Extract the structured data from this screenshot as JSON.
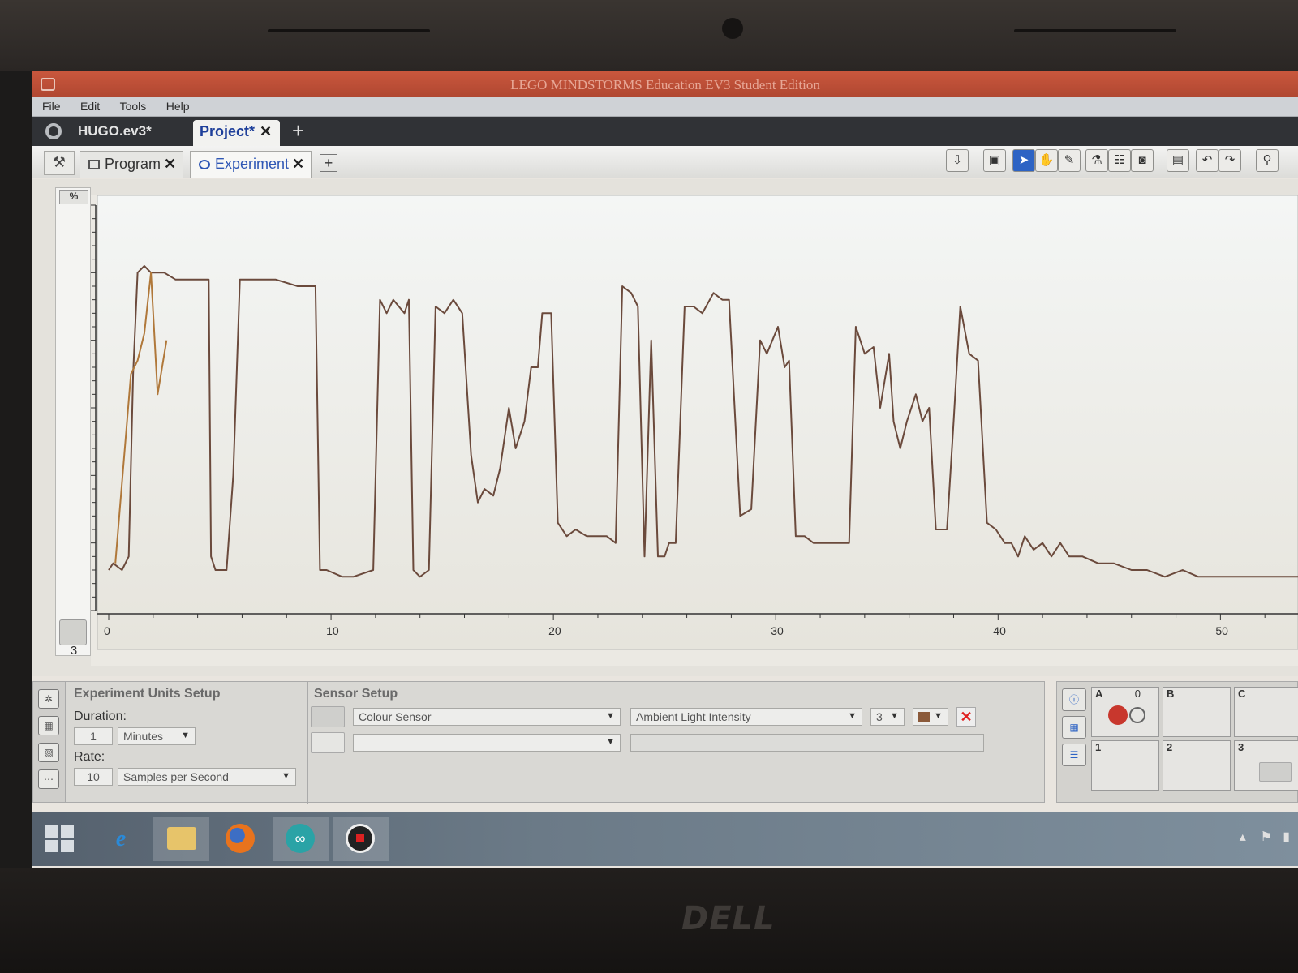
{
  "window": {
    "title": "LEGO MINDSTORMS Education EV3 Student Edition"
  },
  "menu": [
    "File",
    "Edit",
    "Tools",
    "Help"
  ],
  "project": {
    "file_label": "HUGO.ev3*",
    "tab_label": "Project*",
    "close": "✕",
    "add": "+"
  },
  "tabs": [
    {
      "label": "Program",
      "close": "✕"
    },
    {
      "label": "Experiment",
      "close": "✕"
    }
  ],
  "add_tab": "+",
  "toolbar_icons": [
    "upload-icon",
    "camera-view-icon",
    "pointer-icon",
    "hand-icon",
    "pencil-icon",
    "flask-icon",
    "dataset-table-icon",
    "snapshot-icon",
    "save-icon",
    "undo-icon",
    "redo-icon",
    "zoom-icon"
  ],
  "chart": {
    "unit_label": "%",
    "port_number": "3"
  },
  "chart_data": {
    "type": "line",
    "title": "",
    "xlabel": "",
    "ylabel": "%",
    "xlim": [
      0,
      54
    ],
    "ylim": [
      0,
      60
    ],
    "x_ticks": [
      0,
      10,
      20,
      30,
      40,
      50
    ],
    "y_ticks": [
      0,
      10,
      20,
      30,
      40,
      50,
      60
    ],
    "grid": false,
    "series": [
      {
        "name": "",
        "color": "#6b4a3c",
        "points": [
          [
            0,
            6
          ],
          [
            0.2,
            7
          ],
          [
            0.6,
            6
          ],
          [
            0.9,
            8
          ],
          [
            1.1,
            35
          ],
          [
            1.3,
            50
          ],
          [
            1.6,
            51
          ],
          [
            1.9,
            50
          ],
          [
            2.5,
            50
          ],
          [
            3,
            49
          ],
          [
            3.7,
            49
          ],
          [
            4,
            49
          ],
          [
            4.5,
            49
          ],
          [
            4.6,
            8
          ],
          [
            4.8,
            6
          ],
          [
            5.1,
            6
          ],
          [
            5.3,
            6
          ],
          [
            5.6,
            20
          ],
          [
            5.9,
            49
          ],
          [
            6.5,
            49
          ],
          [
            7.5,
            49
          ],
          [
            8.5,
            48
          ],
          [
            9,
            48
          ],
          [
            9.3,
            48
          ],
          [
            9.5,
            6
          ],
          [
            9.8,
            6
          ],
          [
            10.5,
            5
          ],
          [
            11,
            5
          ],
          [
            11.9,
            6
          ],
          [
            12.2,
            46
          ],
          [
            12.5,
            44
          ],
          [
            12.8,
            46
          ],
          [
            13.3,
            44
          ],
          [
            13.5,
            46
          ],
          [
            13.7,
            6
          ],
          [
            14,
            5
          ],
          [
            14.4,
            6
          ],
          [
            14.7,
            45
          ],
          [
            15.1,
            44
          ],
          [
            15.5,
            46
          ],
          [
            15.9,
            44
          ],
          [
            16.3,
            23
          ],
          [
            16.6,
            16
          ],
          [
            16.9,
            18
          ],
          [
            17.3,
            17
          ],
          [
            17.6,
            21
          ],
          [
            18,
            30
          ],
          [
            18.3,
            24
          ],
          [
            18.7,
            28
          ],
          [
            19,
            36
          ],
          [
            19.3,
            36
          ],
          [
            19.5,
            44
          ],
          [
            19.9,
            44
          ],
          [
            20.2,
            13
          ],
          [
            20.6,
            11
          ],
          [
            21,
            12
          ],
          [
            21.5,
            11
          ],
          [
            22,
            11
          ],
          [
            22.4,
            11
          ],
          [
            22.8,
            10
          ],
          [
            23.1,
            48
          ],
          [
            23.5,
            47
          ],
          [
            23.8,
            45
          ],
          [
            24.1,
            8
          ],
          [
            24.4,
            40
          ],
          [
            24.7,
            8
          ],
          [
            25,
            8
          ],
          [
            25.2,
            10
          ],
          [
            25.5,
            10
          ],
          [
            25.9,
            45
          ],
          [
            26.3,
            45
          ],
          [
            26.7,
            44
          ],
          [
            27.2,
            47
          ],
          [
            27.6,
            46
          ],
          [
            27.9,
            46
          ],
          [
            28.4,
            14
          ],
          [
            28.9,
            15
          ],
          [
            29.3,
            40
          ],
          [
            29.6,
            38
          ],
          [
            30.1,
            42
          ],
          [
            30.4,
            36
          ],
          [
            30.6,
            37
          ],
          [
            30.9,
            11
          ],
          [
            31.3,
            11
          ],
          [
            31.7,
            10
          ],
          [
            32.6,
            10
          ],
          [
            33.3,
            10
          ],
          [
            33.6,
            42
          ],
          [
            34,
            38
          ],
          [
            34.4,
            39
          ],
          [
            34.7,
            30
          ],
          [
            35.1,
            38
          ],
          [
            35.3,
            28
          ],
          [
            35.6,
            24
          ],
          [
            35.9,
            28
          ],
          [
            36.3,
            32
          ],
          [
            36.6,
            28
          ],
          [
            36.9,
            30
          ],
          [
            37.2,
            12
          ],
          [
            37.7,
            12
          ],
          [
            38,
            28
          ],
          [
            38.3,
            45
          ],
          [
            38.7,
            38
          ],
          [
            39.1,
            37
          ],
          [
            39.5,
            13
          ],
          [
            39.9,
            12
          ],
          [
            40.3,
            10
          ],
          [
            40.6,
            10
          ],
          [
            40.9,
            8
          ],
          [
            41.2,
            11
          ],
          [
            41.6,
            9
          ],
          [
            42,
            10
          ],
          [
            42.4,
            8
          ],
          [
            42.8,
            10
          ],
          [
            43.2,
            8
          ],
          [
            43.8,
            8
          ],
          [
            44.5,
            7
          ],
          [
            45.2,
            7
          ],
          [
            46,
            6
          ],
          [
            46.7,
            6
          ],
          [
            47.5,
            5
          ],
          [
            48.3,
            6
          ],
          [
            49,
            5
          ],
          [
            49.8,
            5
          ],
          [
            50.5,
            5
          ],
          [
            51.3,
            5
          ],
          [
            52,
            5
          ],
          [
            53,
            5
          ],
          [
            54,
            5
          ]
        ]
      },
      {
        "name": "",
        "color": "#b0783a",
        "points": [
          [
            0.3,
            7
          ],
          [
            0.7,
            23
          ],
          [
            1,
            35
          ],
          [
            1.3,
            37
          ],
          [
            1.6,
            41
          ],
          [
            1.9,
            50
          ],
          [
            2.2,
            32
          ],
          [
            2.6,
            40
          ]
        ]
      }
    ]
  },
  "experiment_setup": {
    "title": "Experiment Units Setup",
    "duration_label": "Duration:",
    "duration_value": "1",
    "duration_unit": "Minutes",
    "rate_label": "Rate:",
    "rate_value": "10",
    "rate_unit": "Samples per Second"
  },
  "sensor_setup": {
    "title": "Sensor Setup",
    "sensor": "Colour Sensor",
    "mode": "Ambient Light Intensity",
    "port": "3",
    "swatch_color": "#8b5a3a",
    "remove": "✕"
  },
  "ports": {
    "A": {
      "label": "A",
      "value": "0"
    },
    "B": {
      "label": "B"
    },
    "C": {
      "label": "C"
    },
    "1": {
      "label": "1"
    },
    "2": {
      "label": "2"
    },
    "3": {
      "label": "3"
    }
  }
}
